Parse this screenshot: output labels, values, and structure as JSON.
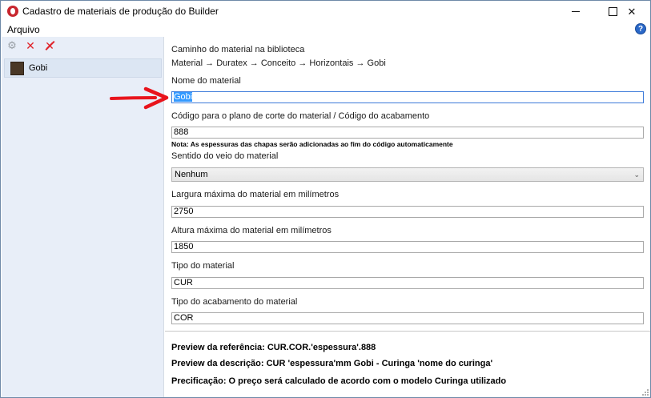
{
  "window": {
    "title": "Cadastro de materiais de produção do Builder",
    "min_glyph": "",
    "max_glyph": "",
    "close_glyph": "✕"
  },
  "menu": {
    "file_label": "Arquivo",
    "help_glyph": "?"
  },
  "sidebar": {
    "tool_icons": [
      "gear-icon",
      "close-icon",
      "delete-all-icon"
    ],
    "items": [
      {
        "label": "Gobi",
        "swatch_color": "#4a3826"
      }
    ]
  },
  "form": {
    "path_label": "Caminho do material na biblioteca",
    "path_value": "Material → Duratex → Conceito → Horizontais → Gobi",
    "name_label": "Nome do material",
    "name_value": "Gobi",
    "code_label": "Código para o plano de corte do material / Código do acabamento",
    "code_value": "888",
    "code_note": "Nota: As espessuras das chapas serão adicionadas ao fim do código automaticamente",
    "grain_label": "Sentido do veio do material",
    "grain_value": "Nenhum",
    "width_label": "Largura máxima do material em milímetros",
    "width_value": "2750",
    "height_label": "Altura máxima do material em milímetros",
    "height_value": "1850",
    "type_label": "Tipo do material",
    "type_value": "CUR",
    "finish_label": "Tipo do acabamento do material",
    "finish_value": "COR"
  },
  "preview": {
    "reference": "Preview da referência: CUR.COR.'espessura'.888",
    "description": "Preview da descrição: CUR 'espessura'mm Gobi - Curinga 'nome do curinga'",
    "pricing": "Precificação: O preço será calculado de acordo com o modelo Curinga utilizado"
  },
  "colors": {
    "accent": "#3399ff",
    "sidebar_bg": "#e8eef8",
    "delete_red": "#e0242b",
    "annotation_arrow": "#e8141c"
  }
}
